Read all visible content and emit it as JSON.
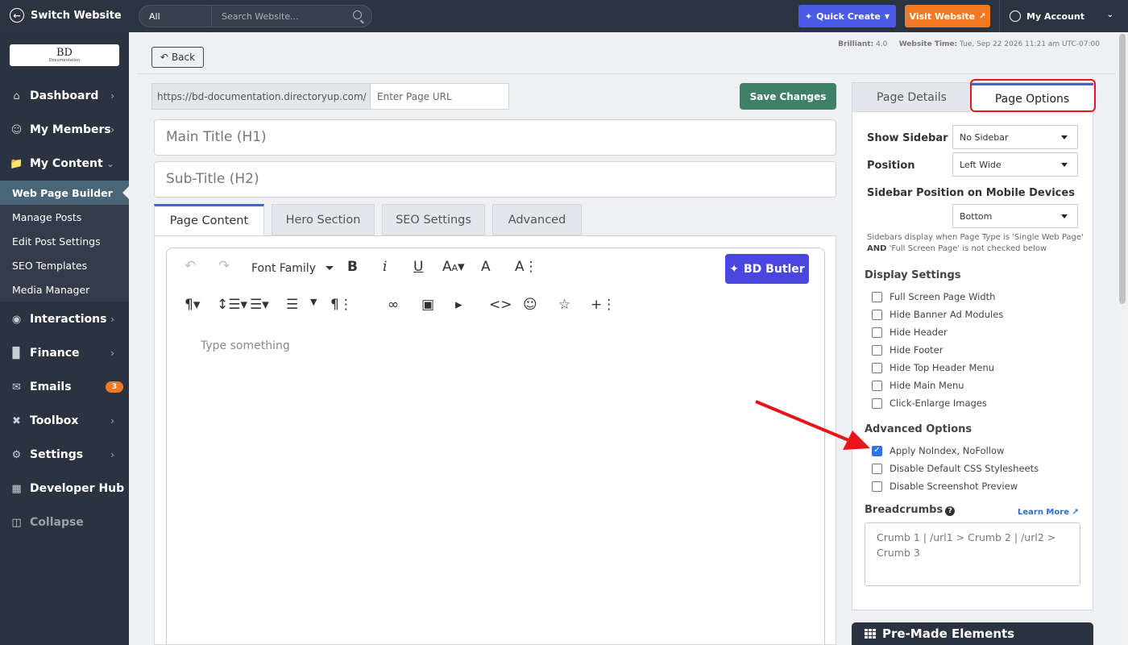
{
  "topbar": {
    "switch_label": "Switch Website",
    "search_scope": "All",
    "search_placeholder": "Search Website...",
    "quick_create": "Quick Create",
    "visit_website": "Visit Website",
    "my_account": "My Account"
  },
  "logo": {
    "title": "BD",
    "subtitle": "Documentation"
  },
  "sidebar": {
    "items": [
      {
        "label": "Dashboard",
        "icon": "home-icon"
      },
      {
        "label": "My Members",
        "icon": "users-icon"
      },
      {
        "label": "My Content",
        "icon": "folder-icon"
      },
      {
        "label": "Interactions",
        "icon": "chat-icon"
      },
      {
        "label": "Finance",
        "icon": "bar-chart-icon"
      },
      {
        "label": "Emails",
        "icon": "mail-icon",
        "badge": "3"
      },
      {
        "label": "Toolbox",
        "icon": "tools-icon"
      },
      {
        "label": "Settings",
        "icon": "gear-icon"
      },
      {
        "label": "Developer Hub",
        "icon": "grid-icon"
      },
      {
        "label": "Collapse",
        "icon": "collapse-icon"
      }
    ],
    "sub_items": [
      "Web Page Builder",
      "Manage Posts",
      "Edit Post Settings",
      "SEO Templates",
      "Media Manager"
    ]
  },
  "header": {
    "back": "Back",
    "version_label": "Brilliant:",
    "version": "4.0",
    "time_label": "Website Time:",
    "time": "Tue, Sep 22 2026 11:21 am UTC-07:00"
  },
  "page": {
    "url_prefix": "https://bd-documentation.directoryup.com/",
    "url_placeholder": "Enter Page URL",
    "save": "Save Changes",
    "main_title_placeholder": "Main Title (H1)",
    "subtitle_placeholder": "Sub-Title (H2)",
    "tabs": [
      "Page Content",
      "Hero Section",
      "SEO Settings",
      "Advanced"
    ]
  },
  "editor": {
    "font_family": "Font Family",
    "butler": "BD Butler",
    "placeholder": "Type something"
  },
  "panel": {
    "tabs": [
      "Page Details",
      "Page Options"
    ],
    "show_sidebar_label": "Show Sidebar",
    "show_sidebar_value": "No Sidebar",
    "position_label": "Position",
    "position_value": "Left Wide",
    "mobile_label": "Sidebar Position on Mobile Devices",
    "mobile_value": "Bottom",
    "note_a": "Sidebars display when Page Type is 'Single Web Page'",
    "note_and": "AND",
    "note_b": "'Full Screen Page' is not checked below",
    "display_title": "Display Settings",
    "display_options": [
      {
        "label": "Full Screen Page Width",
        "checked": false
      },
      {
        "label": "Hide Banner Ad Modules",
        "checked": false
      },
      {
        "label": "Hide Header",
        "checked": false
      },
      {
        "label": "Hide Footer",
        "checked": false
      },
      {
        "label": "Hide Top Header Menu",
        "checked": false
      },
      {
        "label": "Hide Main Menu",
        "checked": false
      },
      {
        "label": "Click-Enlarge Images",
        "checked": false
      }
    ],
    "advanced_title": "Advanced Options",
    "advanced_options": [
      {
        "label": "Apply NoIndex, NoFollow",
        "checked": true
      },
      {
        "label": "Disable Default CSS Stylesheets",
        "checked": false
      },
      {
        "label": "Disable Screenshot Preview",
        "checked": false
      }
    ],
    "breadcrumbs_title": "Breadcrumbs",
    "learn_more": "Learn More",
    "breadcrumbs_placeholder": "Crumb 1 | /url1 > Crumb 2 | /url2 > Crumb 3"
  },
  "premade": "Pre-Made Elements",
  "colors": {
    "accent": "#3f66c8",
    "save": "#3f8068",
    "quick_create": "#4a5be6",
    "visit": "#f07a23",
    "annotation": "#e8151b"
  }
}
